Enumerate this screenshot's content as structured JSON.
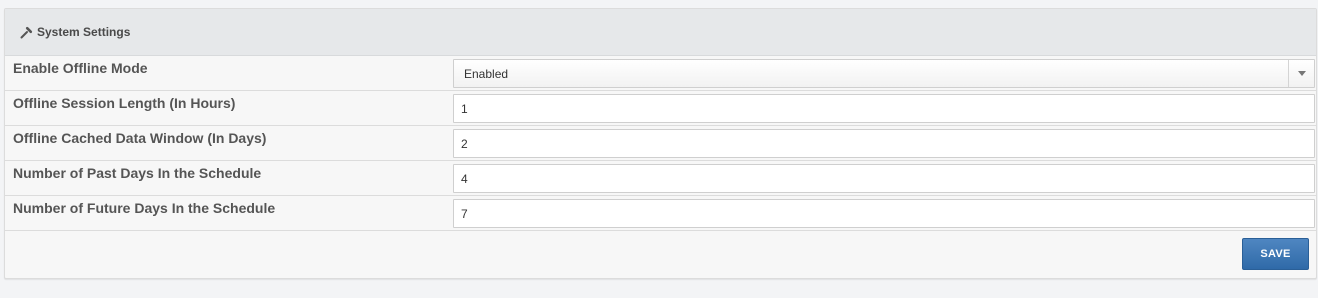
{
  "panel": {
    "title": "System Settings",
    "icon": "wrench-icon"
  },
  "settings": [
    {
      "label": "Enable Offline Mode",
      "value": "Enabled",
      "type": "select"
    },
    {
      "label": "Offline Session Length (In Hours)",
      "value": "1",
      "type": "input"
    },
    {
      "label": "Offline Cached Data Window (In Days)",
      "value": "2",
      "type": "input"
    },
    {
      "label": "Number of Past Days In the Schedule",
      "value": "4",
      "type": "input"
    },
    {
      "label": "Number of Future Days In the Schedule",
      "value": "7",
      "type": "input"
    }
  ],
  "footer": {
    "save_label": "SAVE"
  },
  "colors": {
    "save_button": "#3a76b4",
    "header_bg": "#e6e8ea",
    "panel_bg": "#f7f7f7"
  }
}
